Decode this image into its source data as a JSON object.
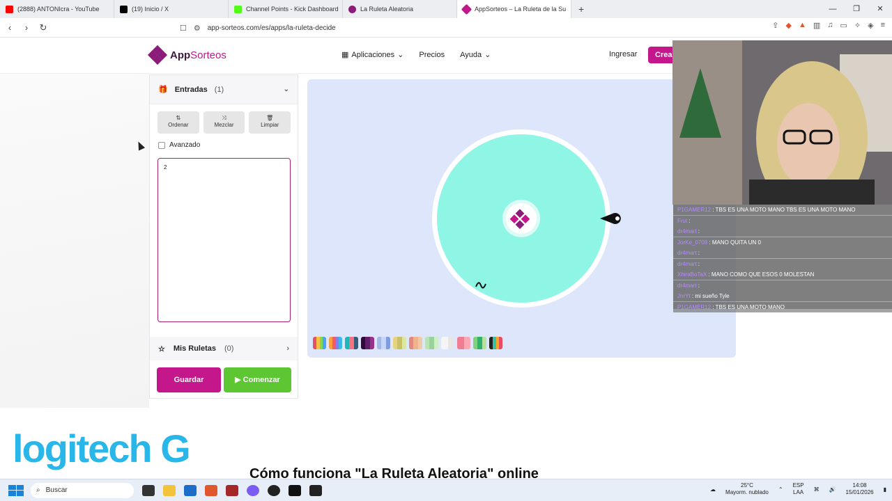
{
  "tabs": [
    {
      "label": "(2888) ANTONIcra - YouTube",
      "color": "#ff0000"
    },
    {
      "label": "(19) Inicio / X",
      "color": "#000000"
    },
    {
      "label": "Channel Points - Kick Dashboard",
      "color": "#53fc18"
    },
    {
      "label": "La Ruleta Aleatoria",
      "color": "#8b1c7a"
    },
    {
      "label": "AppSorteos – La Ruleta de la Su",
      "color": "#c3178b",
      "active": true
    }
  ],
  "address": {
    "url": "app-sorteos.com/es/apps/la-ruleta-decide"
  },
  "header": {
    "brand_a": "App",
    "brand_b": "Sorteos",
    "nav": {
      "apps": "Aplicaciones",
      "pricing": "Precios",
      "help": "Ayuda"
    },
    "login": "Ingresar",
    "cta": "Crear"
  },
  "panel": {
    "entries_title": "Entradas",
    "entries_count": "(1)",
    "tools": {
      "order": "Ordenar",
      "shuffle": "Mezclar",
      "clear": "Limpiar"
    },
    "advanced": "Avanzado",
    "entries_value": "2",
    "my_wheels": "Mis Ruletas",
    "my_wheels_count": "(0)",
    "save": "Guardar",
    "start": "Comenzar"
  },
  "wheel": {
    "segment_color": "#8ff5e4",
    "stage_color": "#dde6fa"
  },
  "palette": [
    [
      "#e94f64",
      "#f6c244",
      "#7ed957",
      "#4ca4f5"
    ],
    [
      "#f9a03f",
      "#f35b6b",
      "#8c7ae6",
      "#3bb9e8"
    ],
    [
      "#1eb6b6",
      "#f67280",
      "#355c7d"
    ],
    [
      "#2d0b3a",
      "#611f69",
      "#9a2f8a"
    ],
    [
      "#a2b9e8",
      "#c8d6f5",
      "#7e9de0"
    ],
    [
      "#e9d27d",
      "#c9c06a",
      "#d8e8a2"
    ],
    [
      "#e28a7e",
      "#efb48c",
      "#f1c9a7"
    ],
    [
      "#b9e3b2",
      "#9ad29c",
      "#d0efc7"
    ],
    [
      "#f5f5f5",
      "#e6e6e6"
    ],
    [
      "#f07d92",
      "#f9a9b6"
    ],
    [
      "#7fd37f",
      "#2fb26b",
      "#b4e3a0"
    ],
    [
      "#222222",
      "#3ac0a5",
      "#f5a623",
      "#e84a5f"
    ]
  ],
  "chat": [
    {
      "user": "P1GAMER12",
      "msg": ": TBS ES UNA MOTO MANO  TBS ES UNA MOTO MANO"
    },
    {
      "user": "Frut",
      "msg": ":"
    },
    {
      "user": "dr4mart",
      "msg": ":"
    },
    {
      "user": "JorKe_0708",
      "msg": ": MANO QUITA UN 0"
    },
    {
      "user": "dr4mart",
      "msg": ":"
    },
    {
      "user": "dr4mart",
      "msg": ":"
    },
    {
      "user": "XhiraBoTaX",
      "msg": ": MANO COMO QUE ESOS 0 MOLESTAN"
    },
    {
      "user": "dr4mart",
      "msg": ":"
    },
    {
      "user": "JnrYt",
      "msg": ": mi sueño Tyle"
    },
    {
      "user": "P1GAMER12",
      "msg": ": TBS ES UNA MOTO MANO"
    }
  ],
  "sponsor": "logitech G",
  "section_heading": "Cómo funciona \"La Ruleta Aleatoria\" online",
  "taskbar": {
    "search": "Buscar",
    "weather_temp": "25°C",
    "weather_desc": "Mayorm. nublado",
    "lang_a": "ESP",
    "lang_b": "LAA",
    "time": "14:08",
    "date": "15/01/2026"
  }
}
